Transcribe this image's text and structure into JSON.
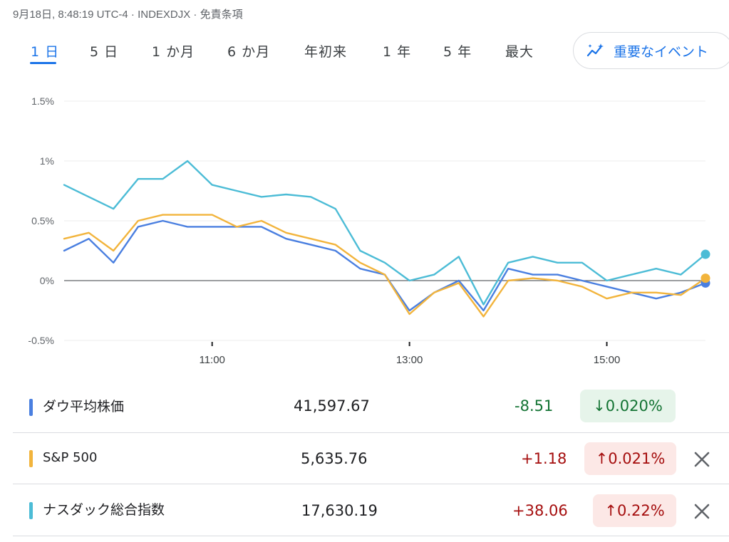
{
  "header": {
    "meta": "9月18日, 8:48:19 UTC-4 · INDEXDJX · 免責条項"
  },
  "tabs": [
    "1 日",
    "5 日",
    "1 か月",
    "6 か月",
    "年初来",
    "1 年",
    "5 年",
    "最大"
  ],
  "events_button": {
    "label": "重要なイベント",
    "icon": "sparkle-chart-icon"
  },
  "chart_data": {
    "type": "line",
    "ylim": [
      -0.5,
      1.5
    ],
    "y_ticks": [
      "1.5%",
      "1%",
      "0.5%",
      "0%",
      "-0.5%"
    ],
    "x_ticks": [
      "11:00",
      "13:00",
      "15:00"
    ],
    "x_range": [
      "9:30",
      "16:00"
    ],
    "baseline": 0,
    "series": [
      {
        "name": "ダウ平均株価",
        "color": "#4a7fe0",
        "x": [
          "9:30",
          "9:45",
          "10:00",
          "10:15",
          "10:30",
          "10:45",
          "11:00",
          "11:15",
          "11:30",
          "11:45",
          "12:00",
          "12:15",
          "12:30",
          "12:45",
          "13:00",
          "13:15",
          "13:30",
          "13:45",
          "14:00",
          "14:15",
          "14:30",
          "14:45",
          "15:00",
          "15:15",
          "15:30",
          "15:45",
          "16:00"
        ],
        "values": [
          0.25,
          0.35,
          0.15,
          0.45,
          0.5,
          0.45,
          0.45,
          0.45,
          0.45,
          0.35,
          0.3,
          0.25,
          0.1,
          0.05,
          -0.25,
          -0.1,
          0.0,
          -0.25,
          0.1,
          0.05,
          0.05,
          0.0,
          -0.05,
          -0.1,
          -0.15,
          -0.1,
          -0.02
        ]
      },
      {
        "name": "S&P 500",
        "color": "#f2b43c",
        "x": [
          "9:30",
          "9:45",
          "10:00",
          "10:15",
          "10:30",
          "10:45",
          "11:00",
          "11:15",
          "11:30",
          "11:45",
          "12:00",
          "12:15",
          "12:30",
          "12:45",
          "13:00",
          "13:15",
          "13:30",
          "13:45",
          "14:00",
          "14:15",
          "14:30",
          "14:45",
          "15:00",
          "15:15",
          "15:30",
          "15:45",
          "16:00"
        ],
        "values": [
          0.35,
          0.4,
          0.25,
          0.5,
          0.55,
          0.55,
          0.55,
          0.45,
          0.5,
          0.4,
          0.35,
          0.3,
          0.15,
          0.05,
          -0.28,
          -0.1,
          -0.02,
          -0.3,
          0.0,
          0.02,
          0.0,
          -0.05,
          -0.15,
          -0.1,
          -0.1,
          -0.12,
          0.02
        ]
      },
      {
        "name": "ナスダック総合指数",
        "color": "#4cbcd6",
        "x": [
          "9:30",
          "9:45",
          "10:00",
          "10:15",
          "10:30",
          "10:45",
          "11:00",
          "11:15",
          "11:30",
          "11:45",
          "12:00",
          "12:15",
          "12:30",
          "12:45",
          "13:00",
          "13:15",
          "13:30",
          "13:45",
          "14:00",
          "14:15",
          "14:30",
          "14:45",
          "15:00",
          "15:15",
          "15:30",
          "15:45",
          "16:00"
        ],
        "values": [
          0.8,
          0.7,
          0.6,
          0.85,
          0.85,
          1.0,
          0.8,
          0.75,
          0.7,
          0.72,
          0.7,
          0.6,
          0.25,
          0.15,
          0.0,
          0.05,
          0.2,
          -0.2,
          0.15,
          0.2,
          0.15,
          0.15,
          0.0,
          0.05,
          0.1,
          0.05,
          0.22
        ]
      }
    ]
  },
  "indices": [
    {
      "name": "ダウ平均株価",
      "price": "41,597.67",
      "change": "-8.51",
      "pct": "↓0.020%",
      "direction": "down",
      "color": "#4a7fe0",
      "closable": false
    },
    {
      "name": "S&P 500",
      "price": "5,635.76",
      "change": "+1.18",
      "pct": "↑0.021%",
      "direction": "up",
      "color": "#f2b43c",
      "closable": true
    },
    {
      "name": "ナスダック総合指数",
      "price": "17,630.19",
      "change": "+38.06",
      "pct": "↑0.22%",
      "direction": "up",
      "color": "#4cbcd6",
      "closable": true
    }
  ],
  "colors": {
    "accent": "#1a73e8",
    "down_bg": "#e6f4ea",
    "down_fg": "#137333",
    "up_bg": "#fce8e6",
    "up_fg": "#a50e0e"
  }
}
